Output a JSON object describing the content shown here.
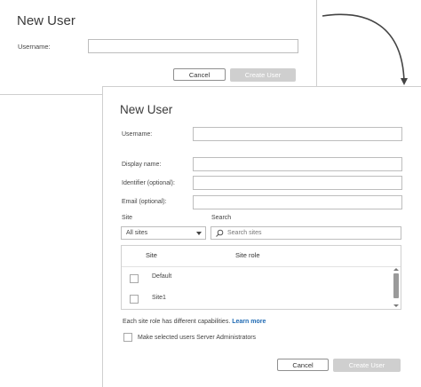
{
  "small_dialog": {
    "title": "New User",
    "username_label": "Username:",
    "username_value": "",
    "cancel_label": "Cancel",
    "create_label": "Create User"
  },
  "large_dialog": {
    "title": "New User",
    "username_label": "Username:",
    "display_name_label": "Display name:",
    "identifier_label": "Identifier (optional):",
    "email_label": "Email (optional):",
    "site_label": "Site",
    "site_value": "All sites",
    "search_label": "Search",
    "search_placeholder": "Search sites",
    "table": {
      "columns": [
        "Site",
        "Site role"
      ],
      "rows": [
        {
          "site": "Default",
          "role": ""
        },
        {
          "site": "Site1",
          "role": ""
        }
      ]
    },
    "info_text": "Each site role has different capabilities.",
    "learn_more": "Learn more",
    "admin_checkbox_label": "Make selected users Server Administrators",
    "cancel_label": "Cancel",
    "create_label": "Create User"
  },
  "colors": {
    "link": "#1f6ab3",
    "disabled_button": "#cfcfcf",
    "border": "#bdbdbd"
  },
  "icons": [
    "search-icon",
    "dropdown-caret-icon",
    "arrow-icon"
  ]
}
